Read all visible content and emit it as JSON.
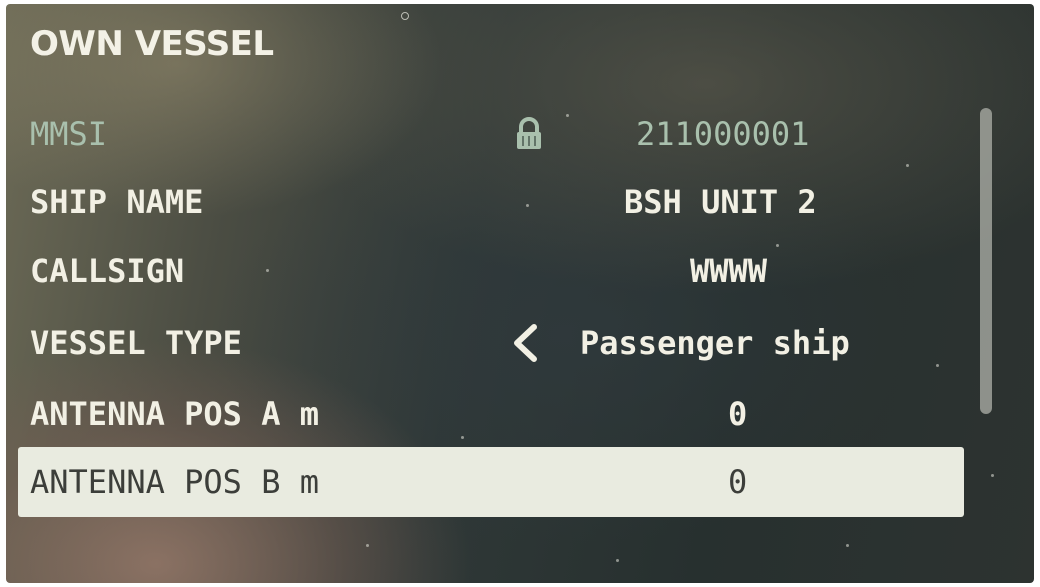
{
  "screen_title": "OWN VESSEL",
  "rows": [
    {
      "label": "MMSI",
      "value": "211000001",
      "locked": true
    },
    {
      "label": "SHIP NAME",
      "value": "BSH UNIT 2"
    },
    {
      "label": "CALLSIGN",
      "value": "WWWW"
    },
    {
      "label": "VESSEL TYPE",
      "value": "Passenger ship"
    },
    {
      "label": "ANTENNA POS A m",
      "value": "0"
    },
    {
      "label": "ANTENNA POS B m",
      "value": "0",
      "selected": true
    }
  ],
  "icons": {
    "lock": "lock-icon",
    "previous": "chevron-left-icon"
  },
  "colors": {
    "text": "#f2f0e4",
    "locked_text": "#a9c0ad",
    "selected_background": "#e9ebe0",
    "selected_text": "#3c3e3a"
  }
}
